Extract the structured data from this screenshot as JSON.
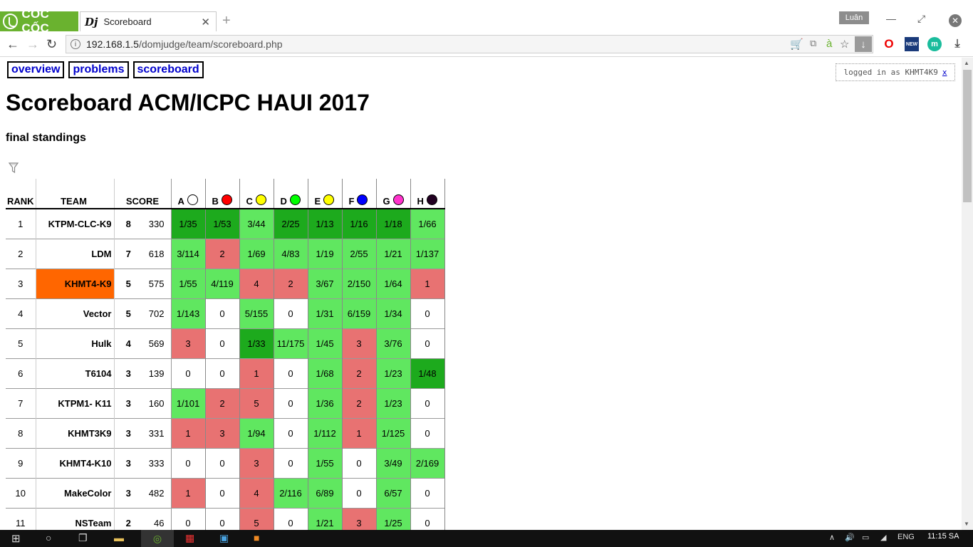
{
  "browser": {
    "brand": "CỐC CỐC",
    "tab_favicon": "Dj",
    "tab_title": "Scoreboard",
    "user": "Luân",
    "url_host": "192.168.1.5",
    "url_path": "/domjudge/team/scoreboard.php"
  },
  "menu": {
    "overview": "overview",
    "problems": "problems",
    "scoreboard": "scoreboard"
  },
  "logged_in": {
    "text": "logged in as KHMT4K9",
    "logout": "x"
  },
  "title": "Scoreboard ACM/ICPC HAUI 2017",
  "subtitle": "final standings",
  "columns": {
    "rank": "RANK",
    "team": "TEAM",
    "score": "SCORE"
  },
  "problems": [
    {
      "letter": "A",
      "color": "#ffffff"
    },
    {
      "letter": "B",
      "color": "#ff0000"
    },
    {
      "letter": "C",
      "color": "#ffff00"
    },
    {
      "letter": "D",
      "color": "#00ff00"
    },
    {
      "letter": "E",
      "color": "#ffff00"
    },
    {
      "letter": "F",
      "color": "#0000ff"
    },
    {
      "letter": "G",
      "color": "#ff33cc"
    },
    {
      "letter": "H",
      "color": "#220022"
    }
  ],
  "cell_colors": {
    "first": "#1daa1d",
    "solved": "#60e760",
    "failed": "#e87272",
    "none": "#ffffff"
  },
  "rows": [
    {
      "rank": "1",
      "team": "KTPM-CLC-K9",
      "solved": "8",
      "time": "330",
      "highlight": false,
      "cells": [
        [
          "1/35",
          "first"
        ],
        [
          "1/53",
          "first"
        ],
        [
          "3/44",
          "solved"
        ],
        [
          "2/25",
          "first"
        ],
        [
          "1/13",
          "first"
        ],
        [
          "1/16",
          "first"
        ],
        [
          "1/18",
          "first"
        ],
        [
          "1/66",
          "solved"
        ]
      ]
    },
    {
      "rank": "2",
      "team": "LDM",
      "solved": "7",
      "time": "618",
      "highlight": false,
      "cells": [
        [
          "3/114",
          "solved"
        ],
        [
          "2",
          "failed"
        ],
        [
          "1/69",
          "solved"
        ],
        [
          "4/83",
          "solved"
        ],
        [
          "1/19",
          "solved"
        ],
        [
          "2/55",
          "solved"
        ],
        [
          "1/21",
          "solved"
        ],
        [
          "1/137",
          "solved"
        ]
      ]
    },
    {
      "rank": "3",
      "team": "KHMT4-K9",
      "solved": "5",
      "time": "575",
      "highlight": true,
      "cells": [
        [
          "1/55",
          "solved"
        ],
        [
          "4/119",
          "solved"
        ],
        [
          "4",
          "failed"
        ],
        [
          "2",
          "failed"
        ],
        [
          "3/67",
          "solved"
        ],
        [
          "2/150",
          "solved"
        ],
        [
          "1/64",
          "solved"
        ],
        [
          "1",
          "failed"
        ]
      ]
    },
    {
      "rank": "4",
      "team": "Vector",
      "solved": "5",
      "time": "702",
      "highlight": false,
      "cells": [
        [
          "1/143",
          "solved"
        ],
        [
          "0",
          "none"
        ],
        [
          "5/155",
          "solved"
        ],
        [
          "0",
          "none"
        ],
        [
          "1/31",
          "solved"
        ],
        [
          "6/159",
          "solved"
        ],
        [
          "1/34",
          "solved"
        ],
        [
          "0",
          "none"
        ]
      ]
    },
    {
      "rank": "5",
      "team": "Hulk",
      "solved": "4",
      "time": "569",
      "highlight": false,
      "cells": [
        [
          "3",
          "failed"
        ],
        [
          "0",
          "none"
        ],
        [
          "1/33",
          "first"
        ],
        [
          "11/175",
          "solved"
        ],
        [
          "1/45",
          "solved"
        ],
        [
          "3",
          "failed"
        ],
        [
          "3/76",
          "solved"
        ],
        [
          "0",
          "none"
        ]
      ]
    },
    {
      "rank": "6",
      "team": "T6104",
      "solved": "3",
      "time": "139",
      "highlight": false,
      "cells": [
        [
          "0",
          "none"
        ],
        [
          "0",
          "none"
        ],
        [
          "1",
          "failed"
        ],
        [
          "0",
          "none"
        ],
        [
          "1/68",
          "solved"
        ],
        [
          "2",
          "failed"
        ],
        [
          "1/23",
          "solved"
        ],
        [
          "1/48",
          "first"
        ]
      ]
    },
    {
      "rank": "7",
      "team": "KTPM1- K11",
      "solved": "3",
      "time": "160",
      "highlight": false,
      "cells": [
        [
          "1/101",
          "solved"
        ],
        [
          "2",
          "failed"
        ],
        [
          "5",
          "failed"
        ],
        [
          "0",
          "none"
        ],
        [
          "1/36",
          "solved"
        ],
        [
          "2",
          "failed"
        ],
        [
          "1/23",
          "solved"
        ],
        [
          "0",
          "none"
        ]
      ]
    },
    {
      "rank": "8",
      "team": "KHMT3K9",
      "solved": "3",
      "time": "331",
      "highlight": false,
      "cells": [
        [
          "1",
          "failed"
        ],
        [
          "3",
          "failed"
        ],
        [
          "1/94",
          "solved"
        ],
        [
          "0",
          "none"
        ],
        [
          "1/112",
          "solved"
        ],
        [
          "1",
          "failed"
        ],
        [
          "1/125",
          "solved"
        ],
        [
          "0",
          "none"
        ]
      ]
    },
    {
      "rank": "9",
      "team": "KHMT4-K10",
      "solved": "3",
      "time": "333",
      "highlight": false,
      "cells": [
        [
          "0",
          "none"
        ],
        [
          "0",
          "none"
        ],
        [
          "3",
          "failed"
        ],
        [
          "0",
          "none"
        ],
        [
          "1/55",
          "solved"
        ],
        [
          "0",
          "none"
        ],
        [
          "3/49",
          "solved"
        ],
        [
          "2/169",
          "solved"
        ]
      ]
    },
    {
      "rank": "10",
      "team": "MakeColor",
      "solved": "3",
      "time": "482",
      "highlight": false,
      "cells": [
        [
          "1",
          "failed"
        ],
        [
          "0",
          "none"
        ],
        [
          "4",
          "failed"
        ],
        [
          "2/116",
          "solved"
        ],
        [
          "6/89",
          "solved"
        ],
        [
          "0",
          "none"
        ],
        [
          "6/57",
          "solved"
        ],
        [
          "0",
          "none"
        ]
      ]
    },
    {
      "rank": "11",
      "team": "NSTeam",
      "solved": "2",
      "time": "46",
      "highlight": false,
      "cells": [
        [
          "0",
          "none"
        ],
        [
          "0",
          "none"
        ],
        [
          "5",
          "failed"
        ],
        [
          "0",
          "none"
        ],
        [
          "1/21",
          "solved"
        ],
        [
          "3",
          "failed"
        ],
        [
          "1/25",
          "solved"
        ],
        [
          "0",
          "none"
        ]
      ]
    }
  ],
  "taskbar": {
    "lang": "ENG",
    "time": "11:15 SA"
  }
}
